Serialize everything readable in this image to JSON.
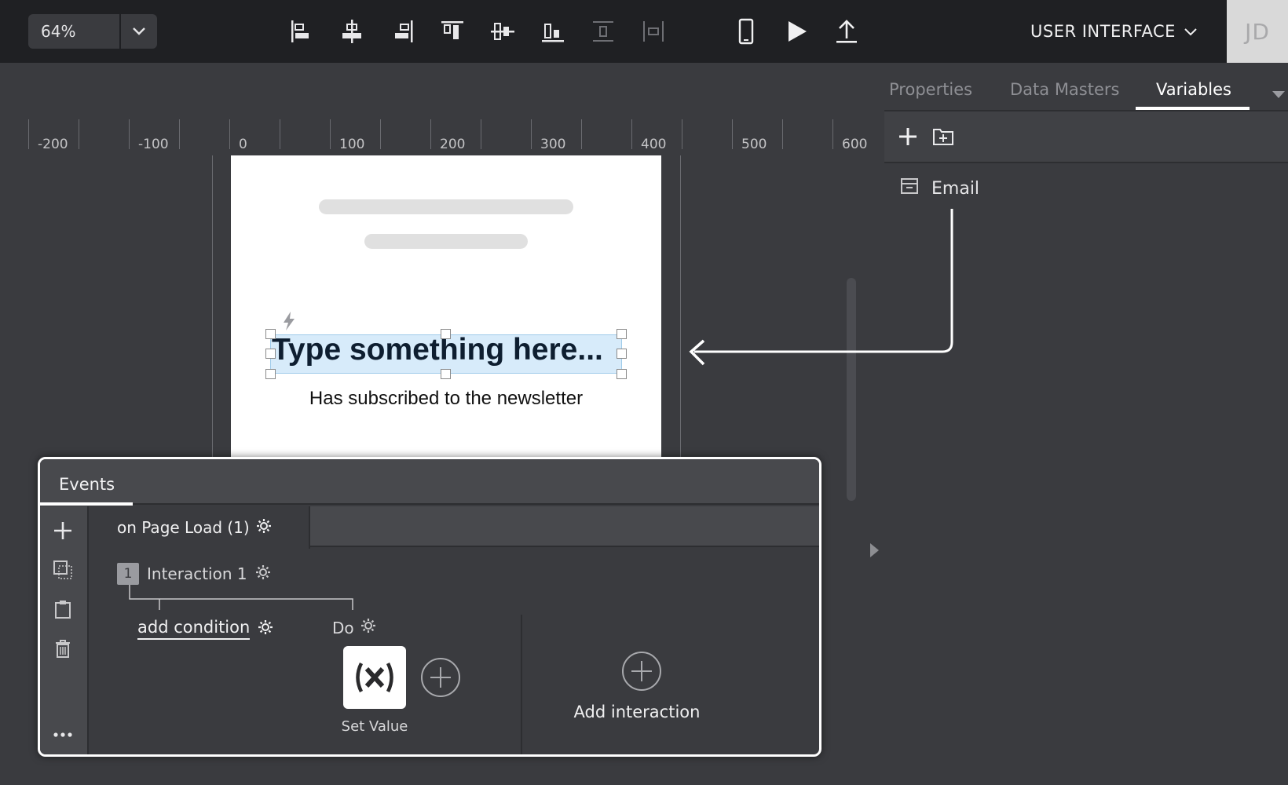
{
  "toolbar": {
    "zoom": "64%",
    "menu_label": "USER INTERFACE",
    "avatar_initials": "JD",
    "icons": [
      "align-left-icon",
      "align-center-icon",
      "align-right-icon",
      "align-top-icon",
      "align-middle-icon",
      "align-bottom-icon",
      "distribute-vertical-icon",
      "distribute-horizontal-icon",
      "device-icon",
      "play-icon",
      "export-icon"
    ]
  },
  "ruler": {
    "labels": [
      "-200",
      "-100",
      "0",
      "100",
      "200",
      "300",
      "400",
      "500",
      "600"
    ]
  },
  "canvas": {
    "text_input_value": "Type something here...",
    "subtitle": "Has subscribed to the newsletter"
  },
  "panel": {
    "tabs": [
      {
        "label": "Properties",
        "active": false
      },
      {
        "label": "Data Masters",
        "active": false
      },
      {
        "label": "Variables",
        "active": true
      }
    ],
    "variables": [
      {
        "name": "Email"
      }
    ]
  },
  "events": {
    "title": "Events",
    "event_tab": "on Page Load (1)",
    "interaction_number": "1",
    "interaction_label": "Interaction 1",
    "condition_label": "add condition",
    "do_label": "Do",
    "action_label": "Set Value",
    "add_interaction_label": "Add interaction"
  },
  "colors": {
    "topbar": "#1f2023",
    "background": "#3a3b3f",
    "selection": "#d7ebfa",
    "accent_white": "#ffffff"
  }
}
